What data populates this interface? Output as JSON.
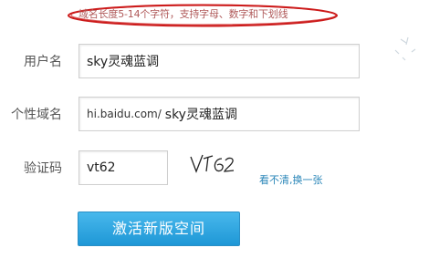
{
  "hint": {
    "text": "域名长度5-14个字符，支持字母、数字和下划线"
  },
  "form": {
    "username": {
      "label": "用户名",
      "value": "sky灵魂蓝调"
    },
    "domain": {
      "label": "个性域名",
      "prefix": "hi.baidu.com/",
      "value": "sky灵魂蓝调"
    },
    "captcha": {
      "label": "验证码",
      "value": "vt62",
      "image_text": "vt62",
      "refresh_link": "看不清,换一张"
    },
    "submit_label": "激活新版空间"
  },
  "colors": {
    "accent": "#1e97d6",
    "hint_oval": "#cc1a1a",
    "link": "#2a86b8"
  }
}
